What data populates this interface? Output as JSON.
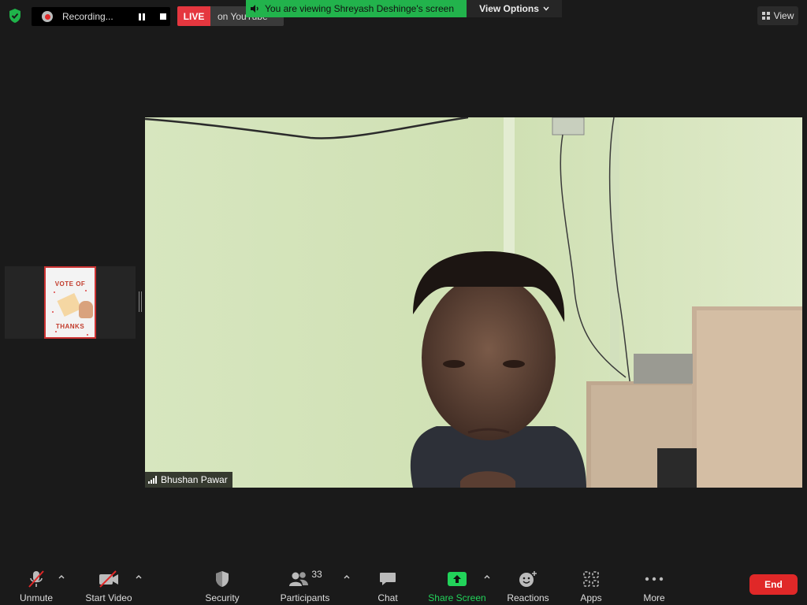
{
  "topbar": {
    "recording": {
      "label": "Recording..."
    },
    "live": {
      "badge": "LIVE",
      "destination": "on YouTube"
    },
    "viewing_banner": "You are viewing Shreyash Deshinge's screen",
    "view_options": "View Options",
    "view": "View"
  },
  "thumbnail": {
    "line1": "VOTE OF",
    "line2": "THANKS"
  },
  "main_video": {
    "participant_name": "Bhushan Pawar"
  },
  "toolbar": {
    "unmute": "Unmute",
    "start_video": "Start Video",
    "security": "Security",
    "participants": "Participants",
    "participants_count": "33",
    "chat": "Chat",
    "share_screen": "Share Screen",
    "reactions": "Reactions",
    "apps": "Apps",
    "more": "More",
    "end": "End"
  },
  "colors": {
    "background": "#1a1a1a",
    "accent_green": "#22b34c",
    "live_red": "#e5373f",
    "end_red": "#e02828",
    "share_green": "#22d35a"
  }
}
